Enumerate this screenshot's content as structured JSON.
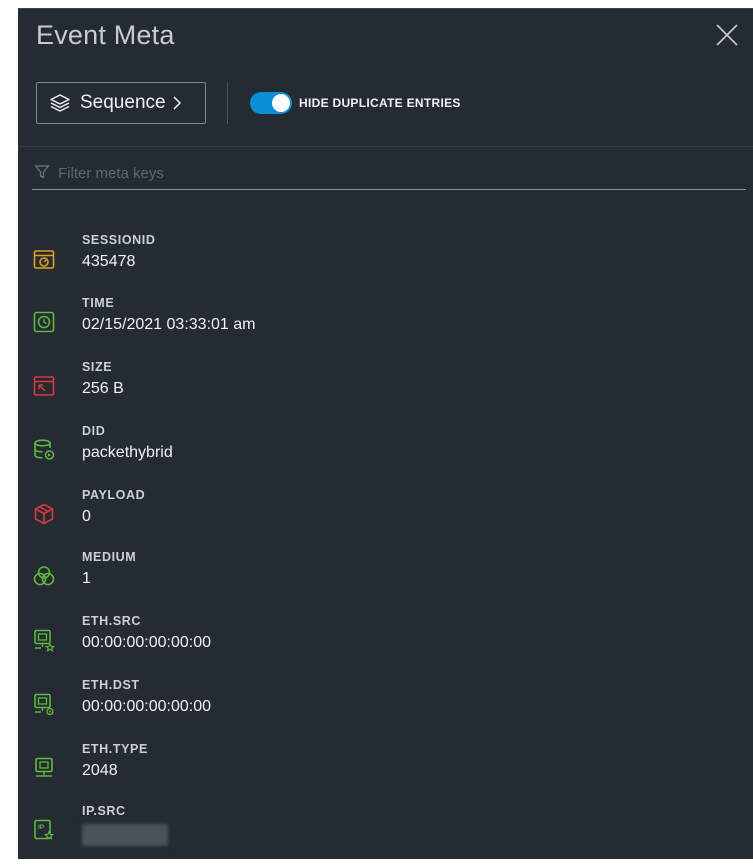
{
  "panel": {
    "title": "Event Meta",
    "close_icon": "close-icon"
  },
  "toolbar": {
    "sequence_label": "Sequence",
    "sequence_icon": "layers-icon",
    "sequence_chevron": "chevron-right-icon",
    "toggle_label": "HIDE DUPLICATE ENTRIES",
    "toggle_on": true,
    "toggle_color": "#0a8fd8"
  },
  "filter": {
    "placeholder": "Filter meta keys",
    "value": "",
    "icon": "filter-icon"
  },
  "meta": [
    {
      "key": "SESSIONID",
      "value": "435478",
      "icon": "session-id-icon",
      "color": "#e0a21c"
    },
    {
      "key": "TIME",
      "value": "02/15/2021 03:33:01 am",
      "icon": "clock-icon",
      "color": "#5fb83c"
    },
    {
      "key": "SIZE",
      "value": "256 B",
      "icon": "size-icon",
      "color": "#d83a3a"
    },
    {
      "key": "DID",
      "value": "packethybrid",
      "icon": "database-icon",
      "color": "#5fb83c"
    },
    {
      "key": "PAYLOAD",
      "value": "0",
      "icon": "cube-icon",
      "color": "#d83a3a"
    },
    {
      "key": "MEDIUM",
      "value": "1",
      "icon": "venn-icon",
      "color": "#5fb83c"
    },
    {
      "key": "ETH.SRC",
      "value": "00:00:00:00:00:00",
      "icon": "ethernet-source-icon",
      "color": "#5fb83c"
    },
    {
      "key": "ETH.DST",
      "value": "00:00:00:00:00:00",
      "icon": "ethernet-destination-icon",
      "color": "#5fb83c"
    },
    {
      "key": "ETH.TYPE",
      "value": "2048",
      "icon": "ethernet-type-icon",
      "color": "#5fb83c"
    },
    {
      "key": "IP.SRC",
      "value": "",
      "icon": "ip-source-icon",
      "color": "#5fb83c"
    }
  ]
}
